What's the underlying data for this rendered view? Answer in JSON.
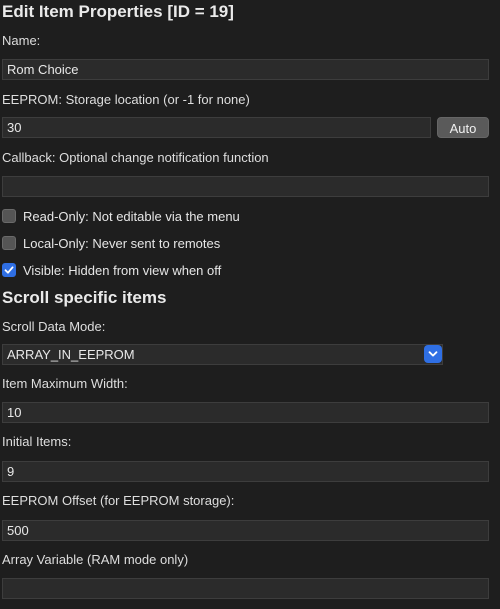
{
  "dialog": {
    "title": "Edit Item Properties [ID = 19]"
  },
  "fields": {
    "name": {
      "label": "Name:",
      "value": "Rom Choice"
    },
    "eeprom": {
      "label": "EEPROM: Storage location (or -1 for none)",
      "value": "30",
      "auto_label": "Auto"
    },
    "callback": {
      "label": "Callback: Optional change notification function",
      "value": ""
    }
  },
  "checkboxes": {
    "read_only": {
      "label": "Read-Only: Not editable via the menu",
      "checked": false
    },
    "local_only": {
      "label": "Local-Only: Never sent to remotes",
      "checked": false
    },
    "visible": {
      "label": "Visible: Hidden from view when off",
      "checked": true
    }
  },
  "scroll": {
    "section_title": "Scroll specific items",
    "data_mode": {
      "label": "Scroll Data Mode:",
      "value": "ARRAY_IN_EEPROM"
    },
    "max_width": {
      "label": "Item Maximum Width:",
      "value": "10"
    },
    "initial_items": {
      "label": "Initial Items:",
      "value": "9"
    },
    "eeprom_offset": {
      "label": "EEPROM Offset (for EEPROM storage):",
      "value": "500"
    },
    "array_variable": {
      "label": "Array Variable (RAM mode only)",
      "value": ""
    }
  },
  "colors": {
    "background": "#1e1e1e",
    "field_background": "#2b2b2b",
    "accent": "#2f6fe4"
  }
}
